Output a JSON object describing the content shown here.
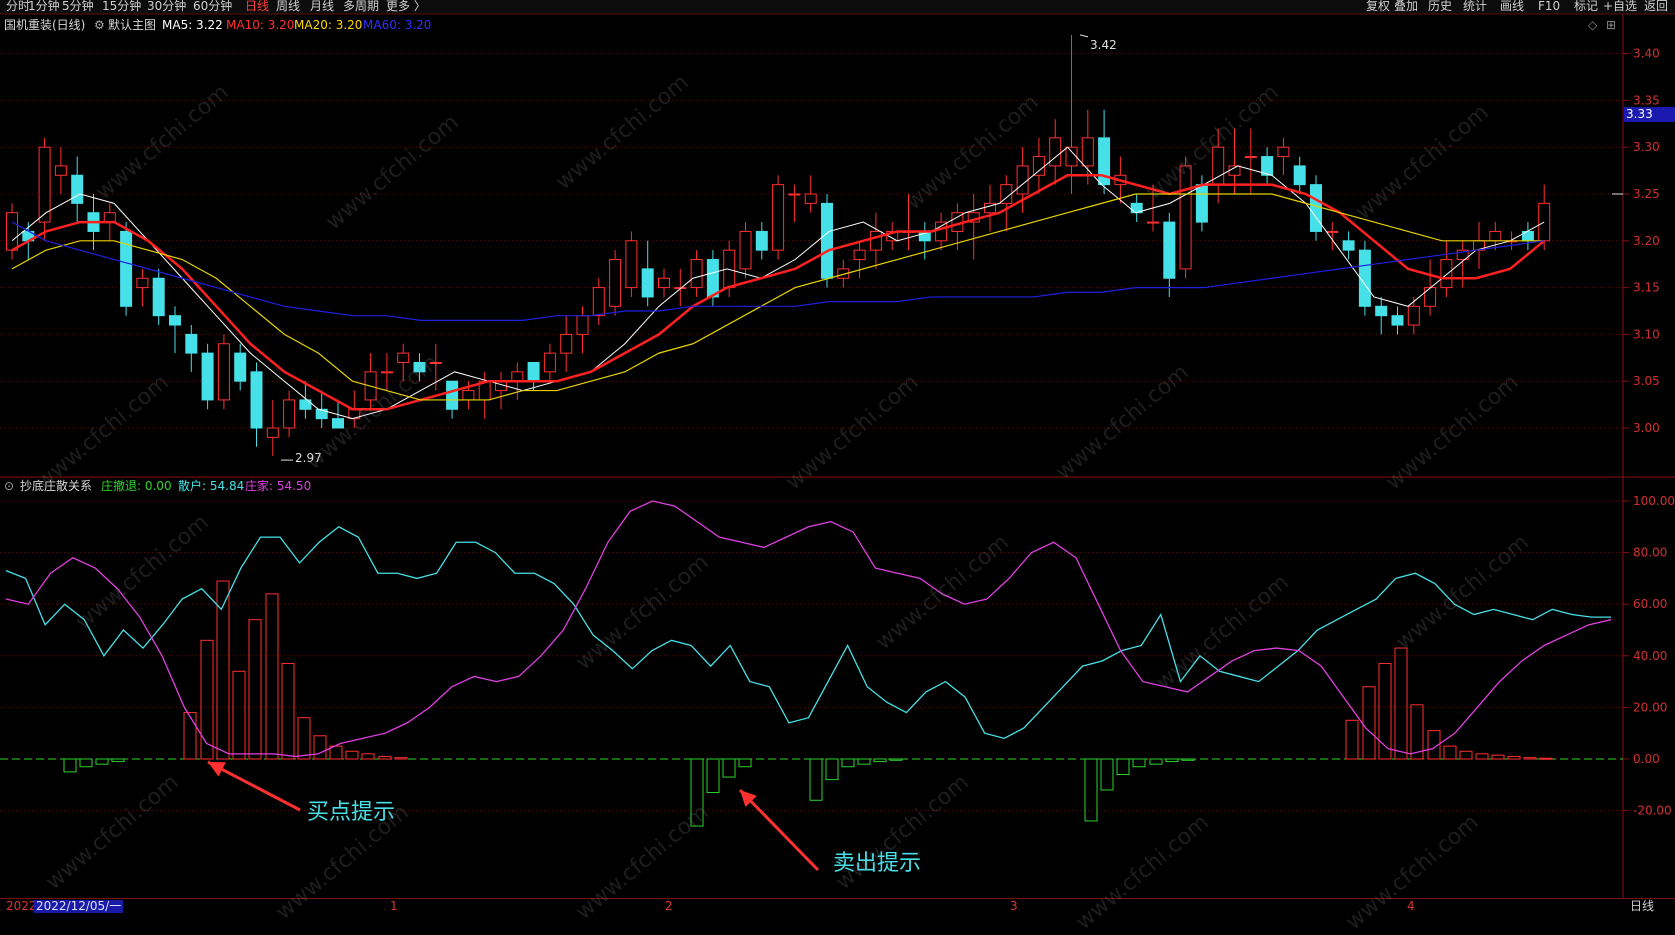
{
  "topbar": {
    "left_items": [
      "分时",
      "1分钟",
      "5分钟",
      "15分钟",
      "30分钟",
      "60分钟",
      "日线",
      "周线",
      "月线",
      "多周期",
      "更多 〉"
    ],
    "active_item": "日线",
    "right_items": [
      "复权",
      "叠加",
      "历史",
      "统计",
      "画线",
      "F10",
      "标记",
      "+自选",
      "返回"
    ]
  },
  "main_panel": {
    "stock_title": "国机重装(日线)",
    "template_label": "默认主图",
    "ma_labels": [
      {
        "name": "MA5: 3.22",
        "color": "#ffffff"
      },
      {
        "name": "MA10: 3.20",
        "color": "#ff3030"
      },
      {
        "name": "MA20: 3.20",
        "color": "#ffd700"
      },
      {
        "name": "MA60: 3.20",
        "color": "#3030ff"
      }
    ],
    "price_axis": [
      "3.40",
      "3.35",
      "3.30",
      "3.25",
      "3.20",
      "3.15",
      "3.10",
      "3.05",
      "3.00"
    ],
    "current_price_tag": "3.33",
    "high_marker": "3.42",
    "low_marker": "2.97"
  },
  "indicator_panel": {
    "title": "抄底庄散关系",
    "legend": [
      {
        "text": "庄撤退: 0.00",
        "color": "#2bd42b"
      },
      {
        "text": "散户: 54.84",
        "color": "#46e0e8"
      },
      {
        "text": "庄家: 54.50",
        "color": "#e040e0"
      }
    ],
    "axis": [
      "100.00",
      "80.00",
      "60.00",
      "40.00",
      "20.00",
      "0.00",
      "-20.00"
    ]
  },
  "bottom_axis": {
    "year_stub": "2022",
    "selected_date": "2022/12/05/一",
    "month_marks": [
      "1",
      "2",
      "3",
      "4"
    ],
    "period_label": "日线"
  },
  "annotations": {
    "buy_label": "买点提示",
    "sell_label": "卖出提示"
  },
  "watermark": "www.cfchi.com",
  "colors": {
    "up": "#ff3030",
    "down": "#46e0e8",
    "ma5": "#ffffff",
    "ma10": "#ff2020",
    "ma20": "#e6d200",
    "ma60": "#2020e0",
    "retail": "#46e0e8",
    "dealer": "#e040e0"
  }
}
